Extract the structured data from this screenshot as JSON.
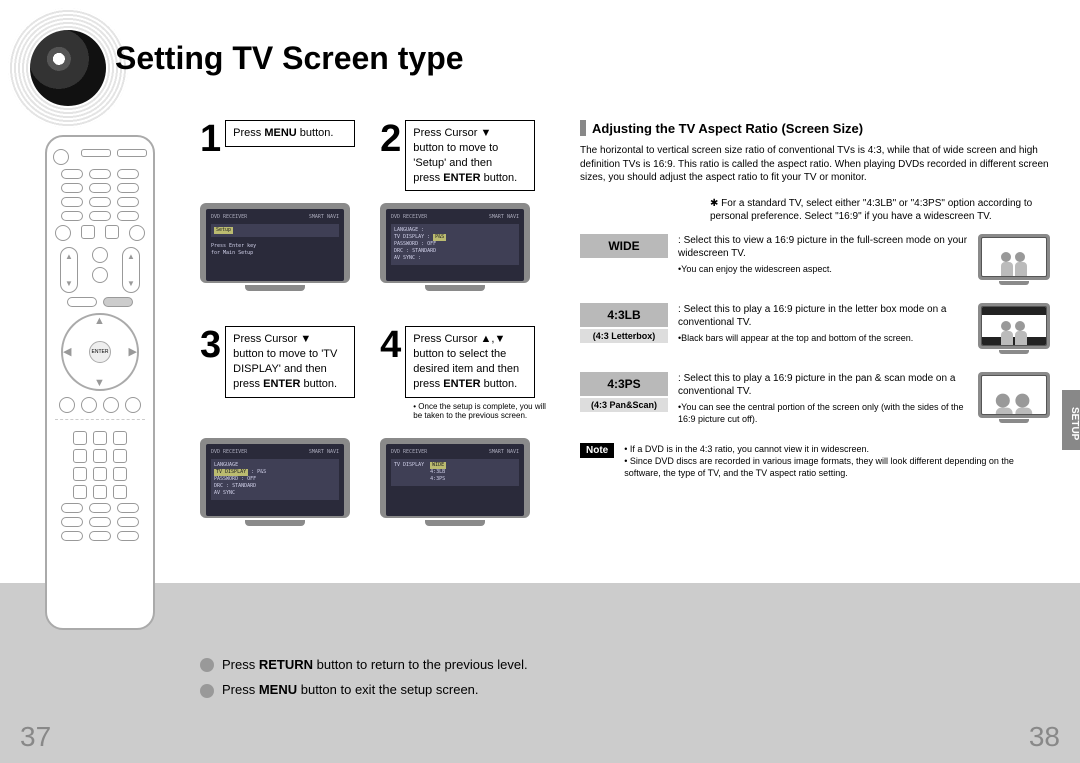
{
  "title": "Setting TV Screen type",
  "page_left": "37",
  "page_right": "38",
  "side_tab": "SETUP",
  "steps": {
    "s1": {
      "num": "1",
      "text_pre": "Press ",
      "bold": "MENU",
      "text_post": " button."
    },
    "s2": {
      "num": "2",
      "line1": "Press Cursor ▼",
      "line2": "button to move to",
      "line3": "'Setup' and then",
      "line4_pre": "press ",
      "line4_bold": "ENTER",
      "line4_post": " button."
    },
    "s3": {
      "num": "3",
      "line1": "Press Cursor ▼",
      "line2": "button to move to 'TV",
      "line3": "DISPLAY' and then",
      "line4_pre": "press ",
      "line4_bold": "ENTER",
      "line4_post": " button."
    },
    "s4": {
      "num": "4",
      "line1": "Press Cursor ▲,▼",
      "line2": "button to select the",
      "line3": "desired item and then",
      "line4_pre": "press ",
      "line4_bold": "ENTER",
      "line4_post": " button.",
      "note": "• Once the setup is complete, you will be taken to the previous screen."
    }
  },
  "osd": {
    "header_left": "DVD RECEIVER",
    "header_right": "SMART NAVI",
    "screen1": {
      "panel": "Setup",
      "hint1": "Press Enter key",
      "hint2": "for Main Setup"
    },
    "screen2": {
      "items": [
        "LANGUAGE",
        "TV DISPLAY",
        "PASSWORD",
        "DRC",
        "AV SYNC"
      ],
      "vals": [
        ": ",
        "P&S",
        "OFF",
        "STANDARD",
        ": "
      ],
      "hl": ""
    },
    "screen3": {
      "items": [
        "LANGUAGE",
        "TV DISPLAY",
        "PASSWORD",
        "DRC",
        "AV SYNC"
      ],
      "vals": [
        ": ",
        "P&S",
        "OFF",
        "STANDARD",
        ": "
      ],
      "hl": "TV DISPLAY"
    },
    "screen4": {
      "items": [
        "TV DISPLAY"
      ],
      "opts": [
        "WIDE",
        "4:3LB",
        "4:3PS"
      ],
      "hl": "WIDE"
    }
  },
  "right": {
    "heading": "Adjusting the TV Aspect Ratio (Screen Size)",
    "intro": "The horizontal to vertical screen size ratio of conventional TVs is 4:3, while that of wide screen and high definition TVs is 16:9. This ratio is called the aspect ratio. When playing DVDs recorded in different screen sizes, you should adjust the aspect ratio to fit your TV or monitor.",
    "pref": "✱ For a standard TV, select either \"4:3LB\" or \"4:3PS\" option according to personal preference. Select \"16:9\" if you have a widescreen TV.",
    "opts": {
      "wide": {
        "label": "WIDE",
        "sub": "",
        "desc": "Select this to view a 16:9 picture in the full-screen mode on your widescreen TV.",
        "sub2": "•You can enjoy the widescreen aspect."
      },
      "lb": {
        "label": "4:3LB",
        "sub": "(4:3 Letterbox)",
        "desc": "Select this to play a 16:9 picture in the letter box mode on a conventional TV.",
        "sub2": "•Black bars will appear at the top and bottom of the screen."
      },
      "ps": {
        "label": "4:3PS",
        "sub": "(4:3 Pan&Scan)",
        "desc": "Select this to play a 16:9 picture in the pan & scan mode on a conventional TV.",
        "sub2": "•You can see the central portion of the screen only (with the sides of the 16:9 picture cut off)."
      }
    },
    "note": {
      "label": "Note",
      "l1": "• If a DVD is in the 4:3 ratio, you cannot view it in widescreen.",
      "l2": "• Since DVD discs are recorded in various image formats, they will look different depending on the software, the type of TV, and the TV aspect ratio setting."
    }
  },
  "footer": {
    "return_pre": "Press ",
    "return_bold": "RETURN",
    "return_post": " button to return to the previous level.",
    "menu_pre": "Press ",
    "menu_bold": "MENU",
    "menu_post": " button to exit the setup screen."
  },
  "remote": {
    "enter": "ENTER"
  }
}
